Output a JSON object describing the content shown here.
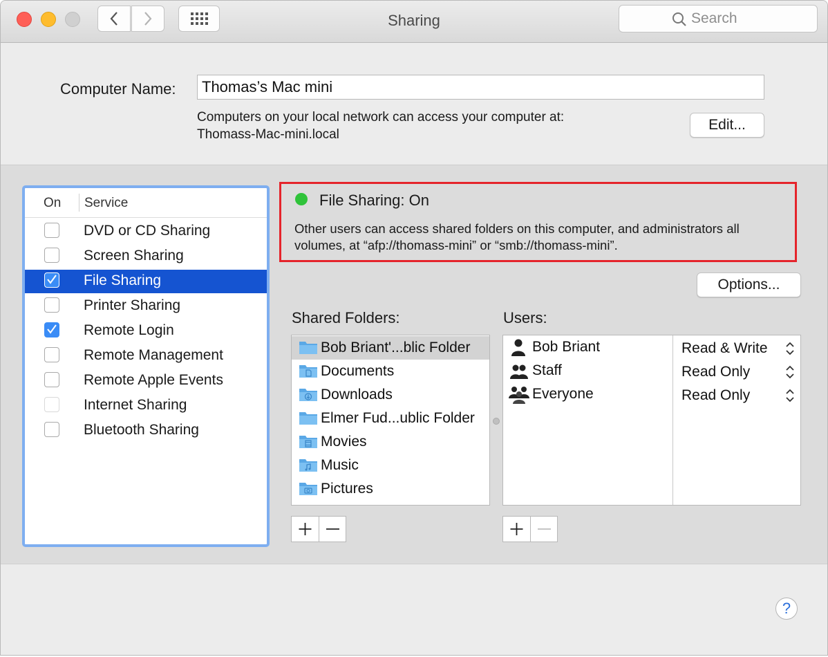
{
  "window": {
    "title": "Sharing",
    "search_placeholder": "Search",
    "traffic_lights": {
      "close": "#fe5f57",
      "minimize": "#febc2e",
      "zoom": "#d0d0d0"
    }
  },
  "computer": {
    "name_label": "Computer Name:",
    "name_value": "Thomas’s Mac mini",
    "access_line1": "Computers on your local network can access your computer at:",
    "access_line2": "Thomass-Mac-mini.local",
    "edit_label": "Edit..."
  },
  "services": {
    "header_on": "On",
    "header_service": "Service",
    "items": [
      {
        "label": "DVD or CD Sharing",
        "checked": false
      },
      {
        "label": "Screen Sharing",
        "checked": false
      },
      {
        "label": "File Sharing",
        "checked": true,
        "selected": true
      },
      {
        "label": "Printer Sharing",
        "checked": false
      },
      {
        "label": "Remote Login",
        "checked": true
      },
      {
        "label": "Remote Management",
        "checked": false
      },
      {
        "label": "Remote Apple Events",
        "checked": false
      },
      {
        "label": "Internet Sharing",
        "checked": false,
        "disabled": true
      },
      {
        "label": "Bluetooth Sharing",
        "checked": false
      }
    ]
  },
  "status": {
    "title": "File Sharing: On",
    "description": "Other users can access shared folders on this computer, and administrators all volumes, at “afp://thomass-mini” or “smb://thomass-mini”.",
    "indicator_color": "#2fc33a"
  },
  "options_label": "Options...",
  "shared_folders": {
    "label": "Shared Folders:",
    "items": [
      {
        "name": "Bob Briant'...blic Folder",
        "icon": "folder-icon"
      },
      {
        "name": "Documents",
        "icon": "documents-folder-icon"
      },
      {
        "name": "Downloads",
        "icon": "downloads-folder-icon"
      },
      {
        "name": "Elmer Fud...ublic Folder",
        "icon": "folder-icon"
      },
      {
        "name": "Movies",
        "icon": "movies-folder-icon"
      },
      {
        "name": "Music",
        "icon": "music-folder-icon"
      },
      {
        "name": "Pictures",
        "icon": "pictures-folder-icon"
      }
    ]
  },
  "users": {
    "label": "Users:",
    "items": [
      {
        "name": "Bob Briant",
        "permission": "Read & Write",
        "icon": "user-icon"
      },
      {
        "name": "Staff",
        "permission": "Read Only",
        "icon": "group-icon"
      },
      {
        "name": "Everyone",
        "permission": "Read Only",
        "icon": "everyone-icon"
      }
    ]
  },
  "buttons": {
    "add": "+",
    "remove": "−"
  },
  "help_label": "?"
}
